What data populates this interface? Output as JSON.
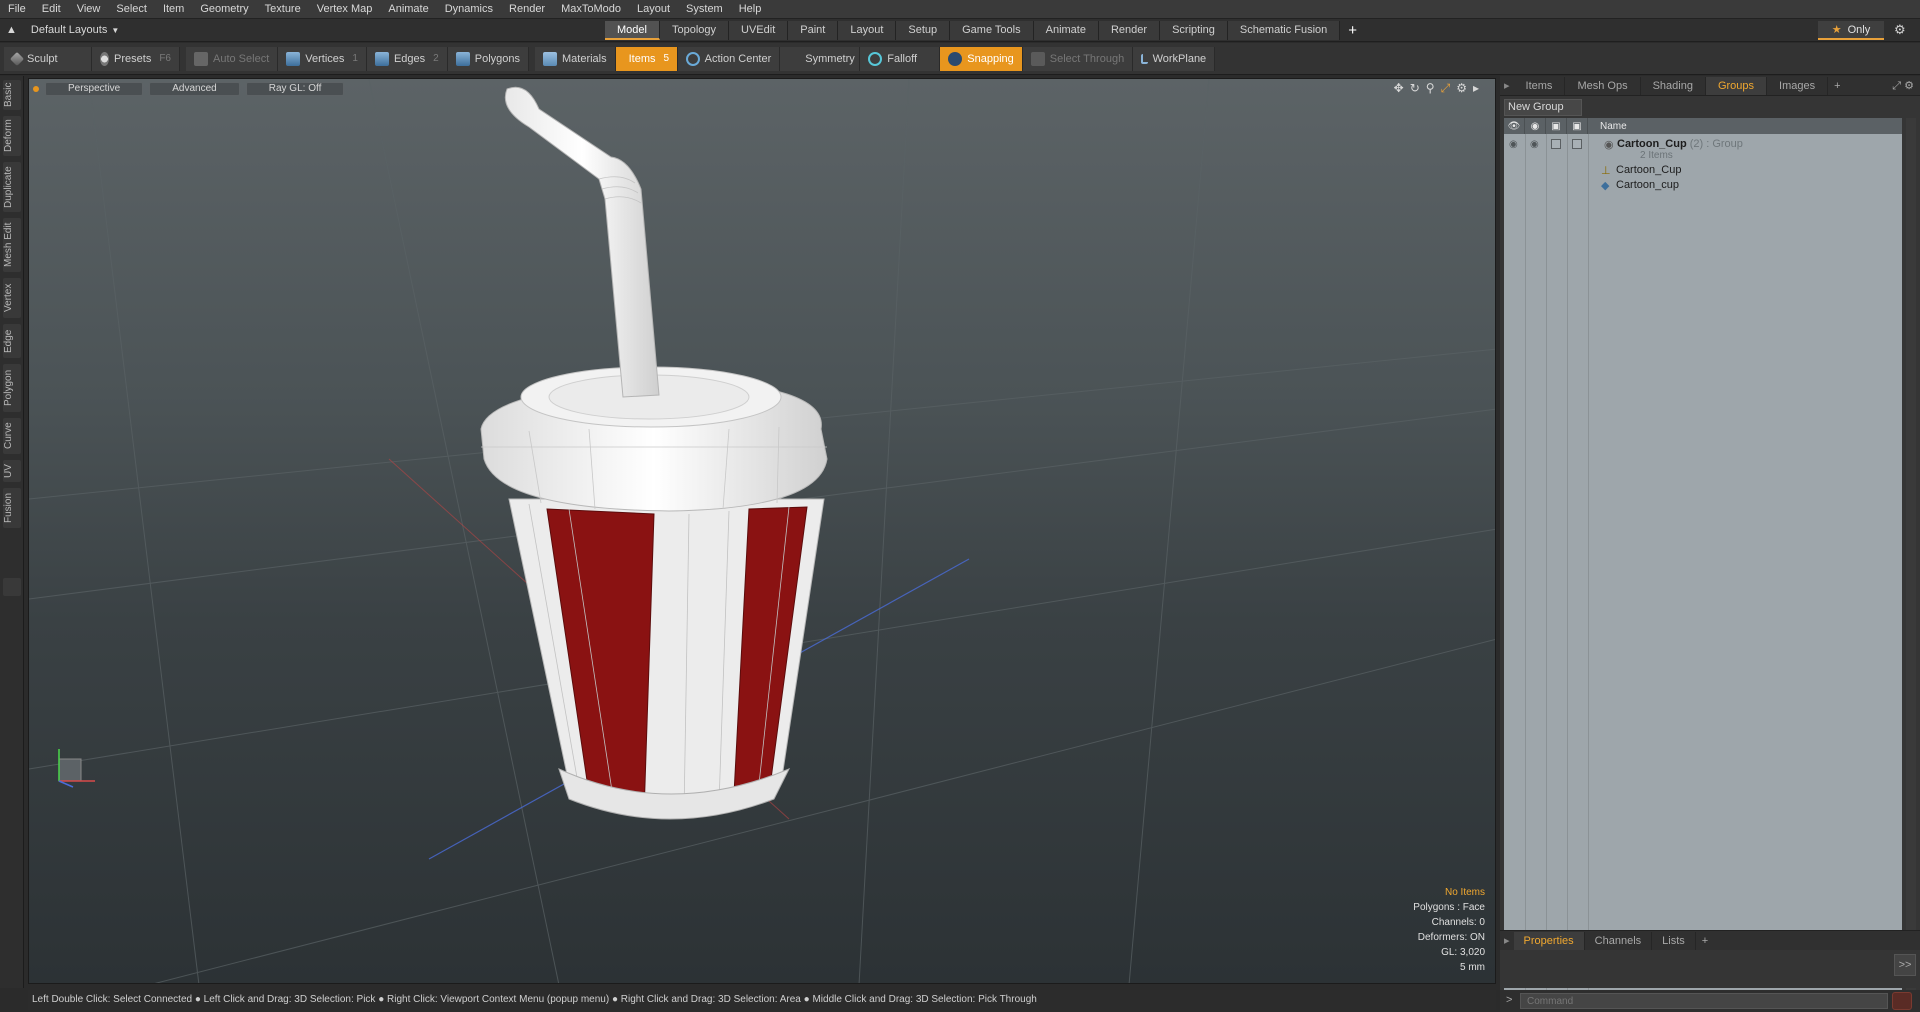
{
  "menu": [
    "File",
    "Edit",
    "View",
    "Select",
    "Item",
    "Geometry",
    "Texture",
    "Vertex Map",
    "Animate",
    "Dynamics",
    "Render",
    "MaxToModo",
    "Layout",
    "System",
    "Help"
  ],
  "layout_switcher": {
    "label": "Default Layouts"
  },
  "layout_tabs": [
    {
      "label": "Model",
      "active": true
    },
    {
      "label": "Topology"
    },
    {
      "label": "UVEdit"
    },
    {
      "label": "Paint"
    },
    {
      "label": "Layout"
    },
    {
      "label": "Setup"
    },
    {
      "label": "Game Tools"
    },
    {
      "label": "Animate"
    },
    {
      "label": "Render"
    },
    {
      "label": "Scripting"
    },
    {
      "label": "Schematic Fusion"
    }
  ],
  "only_button": "Only",
  "toolbar": {
    "sculpt": "Sculpt",
    "presets": "Presets",
    "presets_key": "F6",
    "auto_select": "Auto Select",
    "vertices": "Vertices",
    "vertices_key": "1",
    "edges": "Edges",
    "edges_key": "2",
    "polygons": "Polygons",
    "materials": "Materials",
    "items": "Items",
    "items_key": "5",
    "action_center": "Action Center",
    "symmetry": "Symmetry",
    "falloff": "Falloff",
    "snapping": "Snapping",
    "select_through": "Select Through",
    "workplane": "WorkPlane"
  },
  "left_tabs": [
    "Basic",
    "Deform",
    "Duplicate",
    "Mesh Edit",
    "Vertex",
    "Edge",
    "Polygon",
    "Curve",
    "UV",
    "Fusion"
  ],
  "viewport": {
    "perspective": "Perspective",
    "advanced": "Advanced",
    "raygl": "Ray GL: Off"
  },
  "info": {
    "no_items": "No Items",
    "polygons": "Polygons : Face",
    "channels": "Channels: 0",
    "deformers": "Deformers: ON",
    "gl": "GL: 3,020",
    "scale": "5 mm"
  },
  "status": "Left Double Click: Select Connected ● Left Click and Drag: 3D Selection: Pick ● Right Click: Viewport Context Menu (popup menu) ● Right Click and Drag: 3D Selection: Area ● Middle Click and Drag: 3D Selection: Pick Through",
  "right_tabs": [
    {
      "label": "Items"
    },
    {
      "label": "Mesh Ops"
    },
    {
      "label": "Shading"
    },
    {
      "label": "Groups",
      "active": true
    },
    {
      "label": "Images"
    }
  ],
  "groups": {
    "new_group": "New Group",
    "col_name": "Name",
    "group_name": "Cartoon_Cup",
    "group_meta": " (2) : Group",
    "group_count": "2 Items",
    "child1": "Cartoon_Cup",
    "child2": "Cartoon_cup"
  },
  "prop_tabs": [
    {
      "label": "Properties",
      "active": true
    },
    {
      "label": "Channels"
    },
    {
      "label": "Lists"
    }
  ],
  "command": {
    "placeholder": "Command"
  },
  "colors": {
    "accent": "#e8961e",
    "stripe_red": "#8a1212",
    "cup_white": "#ececec"
  }
}
